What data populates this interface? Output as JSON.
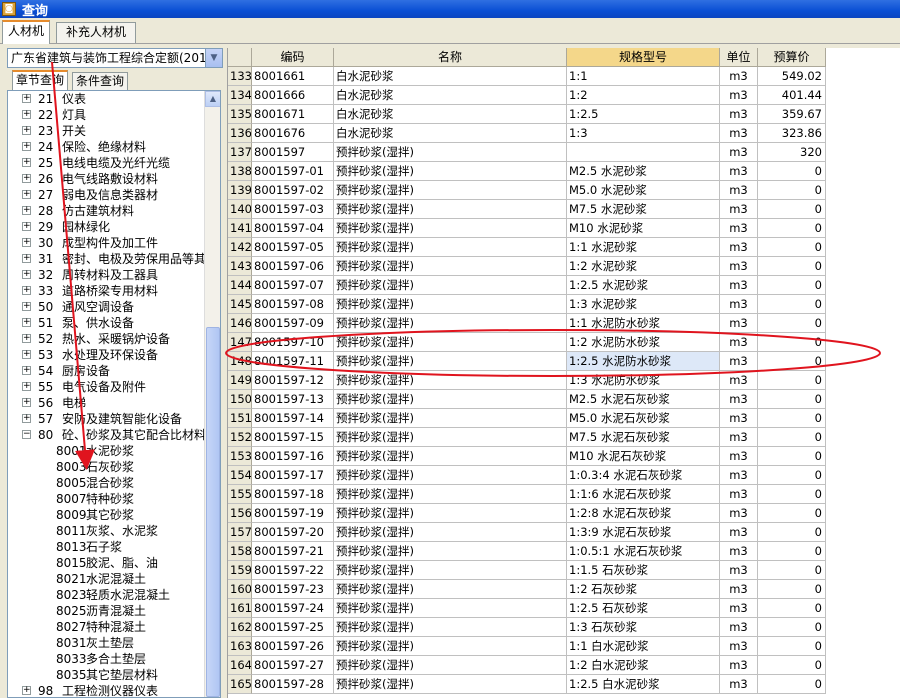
{
  "window": {
    "title": "查询"
  },
  "top_tabs": [
    {
      "label": "人材机"
    },
    {
      "label": "补充人材机"
    }
  ],
  "quota_select": {
    "value": "广东省建筑与装饰工程综合定额(201"
  },
  "sub_tabs": [
    {
      "label": "章节查询"
    },
    {
      "label": "条件查询"
    }
  ],
  "tree": {
    "chapters": [
      {
        "code": "21",
        "label": "仪表",
        "expander": "+"
      },
      {
        "code": "22",
        "label": "灯具",
        "expander": "+"
      },
      {
        "code": "23",
        "label": "开关",
        "expander": "+"
      },
      {
        "code": "24",
        "label": "保险、绝缘材料",
        "expander": "+"
      },
      {
        "code": "25",
        "label": "电线电缆及光纤光缆",
        "expander": "+"
      },
      {
        "code": "26",
        "label": "电气线路敷设材料",
        "expander": "+"
      },
      {
        "code": "27",
        "label": "弱电及信息类器材",
        "expander": "+"
      },
      {
        "code": "28",
        "label": "仿古建筑材料",
        "expander": "+"
      },
      {
        "code": "29",
        "label": "园林绿化",
        "expander": "+"
      },
      {
        "code": "30",
        "label": "成型构件及加工件",
        "expander": "+"
      },
      {
        "code": "31",
        "label": "密封、电极及劳保用品等其",
        "expander": "+"
      },
      {
        "code": "32",
        "label": "周转材料及工器具",
        "expander": "+"
      },
      {
        "code": "33",
        "label": "道路桥梁专用材料",
        "expander": "+"
      },
      {
        "code": "50",
        "label": "通风空调设备",
        "expander": "+"
      },
      {
        "code": "51",
        "label": "泵、供水设备",
        "expander": "+"
      },
      {
        "code": "52",
        "label": "热水、采暖锅炉设备",
        "expander": "+"
      },
      {
        "code": "53",
        "label": "水处理及环保设备",
        "expander": "+"
      },
      {
        "code": "54",
        "label": "厨房设备",
        "expander": "+"
      },
      {
        "code": "55",
        "label": "电气设备及附件",
        "expander": "+"
      },
      {
        "code": "56",
        "label": "电梯",
        "expander": "+"
      },
      {
        "code": "57",
        "label": "安防及建筑智能化设备",
        "expander": "+"
      },
      {
        "code": "80",
        "label": "砼、砂浆及其它配合比材料",
        "expander": "−"
      }
    ],
    "children": [
      {
        "code": "8001",
        "label": "水泥砂浆"
      },
      {
        "code": "8003",
        "label": "石灰砂浆"
      },
      {
        "code": "8005",
        "label": "混合砂浆"
      },
      {
        "code": "8007",
        "label": "特种砂浆"
      },
      {
        "code": "8009",
        "label": "其它砂浆"
      },
      {
        "code": "8011",
        "label": "灰浆、水泥浆"
      },
      {
        "code": "8013",
        "label": "石子浆"
      },
      {
        "code": "8015",
        "label": "胶泥、脂、油"
      },
      {
        "code": "8021",
        "label": "水泥混凝土"
      },
      {
        "code": "8023",
        "label": "轻质水泥混凝土"
      },
      {
        "code": "8025",
        "label": "沥青混凝土"
      },
      {
        "code": "8027",
        "label": "特种混凝土"
      },
      {
        "code": "8031",
        "label": "灰土垫层"
      },
      {
        "code": "8033",
        "label": "多合土垫层"
      },
      {
        "code": "8035",
        "label": "其它垫层材料"
      }
    ],
    "last": {
      "code": "98",
      "label": "工程检测仪器仪表",
      "expander": "+"
    }
  },
  "grid": {
    "headers": [
      "",
      "编码",
      "名称",
      "规格型号",
      "单位",
      "预算价"
    ],
    "rows": [
      [
        "133",
        "8001661",
        "白水泥砂浆",
        "1:1",
        "m3",
        "549.02"
      ],
      [
        "134",
        "8001666",
        "白水泥砂浆",
        "1:2",
        "m3",
        "401.44"
      ],
      [
        "135",
        "8001671",
        "白水泥砂浆",
        "1:2.5",
        "m3",
        "359.67"
      ],
      [
        "136",
        "8001676",
        "白水泥砂浆",
        "1:3",
        "m3",
        "323.86"
      ],
      [
        "137",
        "8001597",
        "预拌砂浆(湿拌)",
        "",
        "m3",
        "320"
      ],
      [
        "138",
        "8001597-01",
        "预拌砂浆(湿拌)",
        "M2.5 水泥砂浆",
        "m3",
        "0"
      ],
      [
        "139",
        "8001597-02",
        "预拌砂浆(湿拌)",
        "M5.0 水泥砂浆",
        "m3",
        "0"
      ],
      [
        "140",
        "8001597-03",
        "预拌砂浆(湿拌)",
        "M7.5 水泥砂浆",
        "m3",
        "0"
      ],
      [
        "141",
        "8001597-04",
        "预拌砂浆(湿拌)",
        "M10 水泥砂浆",
        "m3",
        "0"
      ],
      [
        "142",
        "8001597-05",
        "预拌砂浆(湿拌)",
        "1:1 水泥砂浆",
        "m3",
        "0"
      ],
      [
        "143",
        "8001597-06",
        "预拌砂浆(湿拌)",
        "1:2 水泥砂浆",
        "m3",
        "0"
      ],
      [
        "144",
        "8001597-07",
        "预拌砂浆(湿拌)",
        "1:2.5 水泥砂浆",
        "m3",
        "0"
      ],
      [
        "145",
        "8001597-08",
        "预拌砂浆(湿拌)",
        "1:3 水泥砂浆",
        "m3",
        "0"
      ],
      [
        "146",
        "8001597-09",
        "预拌砂浆(湿拌)",
        "1:1 水泥防水砂浆",
        "m3",
        "0"
      ],
      [
        "147",
        "8001597-10",
        "预拌砂浆(湿拌)",
        "1:2 水泥防水砂浆",
        "m3",
        "0"
      ],
      [
        "148",
        "8001597-11",
        "预拌砂浆(湿拌)",
        "1:2.5 水泥防水砂浆",
        "m3",
        "0"
      ],
      [
        "149",
        "8001597-12",
        "预拌砂浆(湿拌)",
        "1:3 水泥防水砂浆",
        "m3",
        "0"
      ],
      [
        "150",
        "8001597-13",
        "预拌砂浆(湿拌)",
        "M2.5 水泥石灰砂浆",
        "m3",
        "0"
      ],
      [
        "151",
        "8001597-14",
        "预拌砂浆(湿拌)",
        "M5.0 水泥石灰砂浆",
        "m3",
        "0"
      ],
      [
        "152",
        "8001597-15",
        "预拌砂浆(湿拌)",
        "M7.5 水泥石灰砂浆",
        "m3",
        "0"
      ],
      [
        "153",
        "8001597-16",
        "预拌砂浆(湿拌)",
        "M10 水泥石灰砂浆",
        "m3",
        "0"
      ],
      [
        "154",
        "8001597-17",
        "预拌砂浆(湿拌)",
        "1:0.3:4 水泥石灰砂浆",
        "m3",
        "0"
      ],
      [
        "155",
        "8001597-18",
        "预拌砂浆(湿拌)",
        "1:1:6 水泥石灰砂浆",
        "m3",
        "0"
      ],
      [
        "156",
        "8001597-19",
        "预拌砂浆(湿拌)",
        "1:2:8 水泥石灰砂浆",
        "m3",
        "0"
      ],
      [
        "157",
        "8001597-20",
        "预拌砂浆(湿拌)",
        "1:3:9 水泥石灰砂浆",
        "m3",
        "0"
      ],
      [
        "158",
        "8001597-21",
        "预拌砂浆(湿拌)",
        "1:0.5:1 水泥石灰砂浆",
        "m3",
        "0"
      ],
      [
        "159",
        "8001597-22",
        "预拌砂浆(湿拌)",
        "1:1.5 石灰砂浆",
        "m3",
        "0"
      ],
      [
        "160",
        "8001597-23",
        "预拌砂浆(湿拌)",
        "1:2 石灰砂浆",
        "m3",
        "0"
      ],
      [
        "161",
        "8001597-24",
        "预拌砂浆(湿拌)",
        "1:2.5 石灰砂浆",
        "m3",
        "0"
      ],
      [
        "162",
        "8001597-25",
        "预拌砂浆(湿拌)",
        "1:3 石灰砂浆",
        "m3",
        "0"
      ],
      [
        "163",
        "8001597-26",
        "预拌砂浆(湿拌)",
        "1:1 白水泥砂浆",
        "m3",
        "0"
      ],
      [
        "164",
        "8001597-27",
        "预拌砂浆(湿拌)",
        "1:2 白水泥砂浆",
        "m3",
        "0"
      ],
      [
        "165",
        "8001597-28",
        "预拌砂浆(湿拌)",
        "1:2.5 白水泥砂浆",
        "m3",
        "0"
      ]
    ],
    "selected_row": 15,
    "highlight_column": 3
  },
  "annotation": {
    "color": "#e0141e"
  },
  "colors": {
    "title_bar": "#0a4fd4",
    "header_highlight": "#f4d78a",
    "selection": "#dde8f8"
  }
}
